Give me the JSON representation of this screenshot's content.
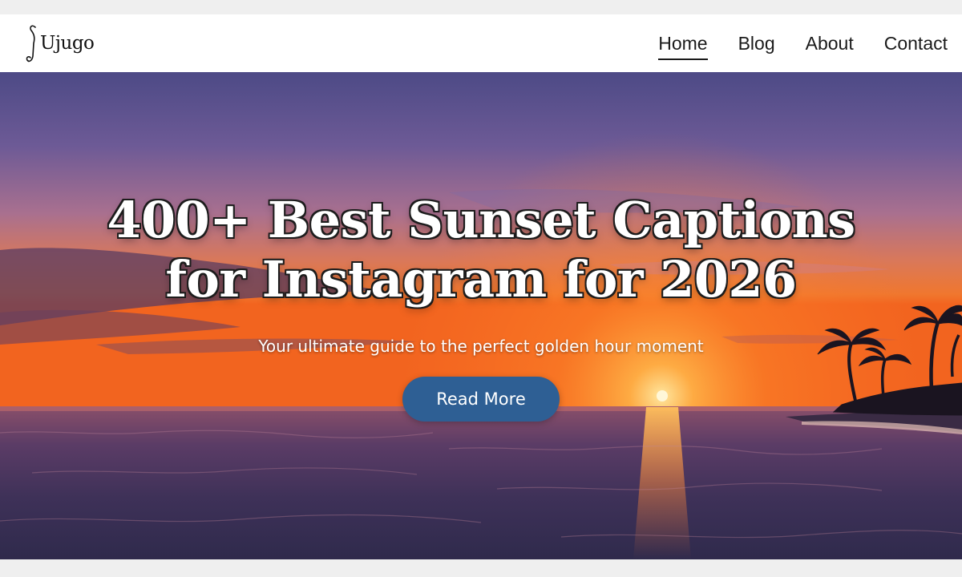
{
  "header": {
    "logo_text": "Ujugo",
    "nav": [
      {
        "label": "Home",
        "active": true
      },
      {
        "label": "Blog",
        "active": false
      },
      {
        "label": "About",
        "active": false
      },
      {
        "label": "Contact",
        "active": false
      }
    ]
  },
  "hero": {
    "title_line1": "400+ Best Sunset Captions",
    "title_line2": "for Instagram for 2026",
    "subtitle": "Your ultimate guide to the perfect golden hour moment",
    "button_label": "Read More",
    "image": "sunset-beach-photo"
  },
  "colors": {
    "button": "#2e5f94",
    "nav_bg": "#ffffff",
    "page_bg": "#efefef"
  }
}
